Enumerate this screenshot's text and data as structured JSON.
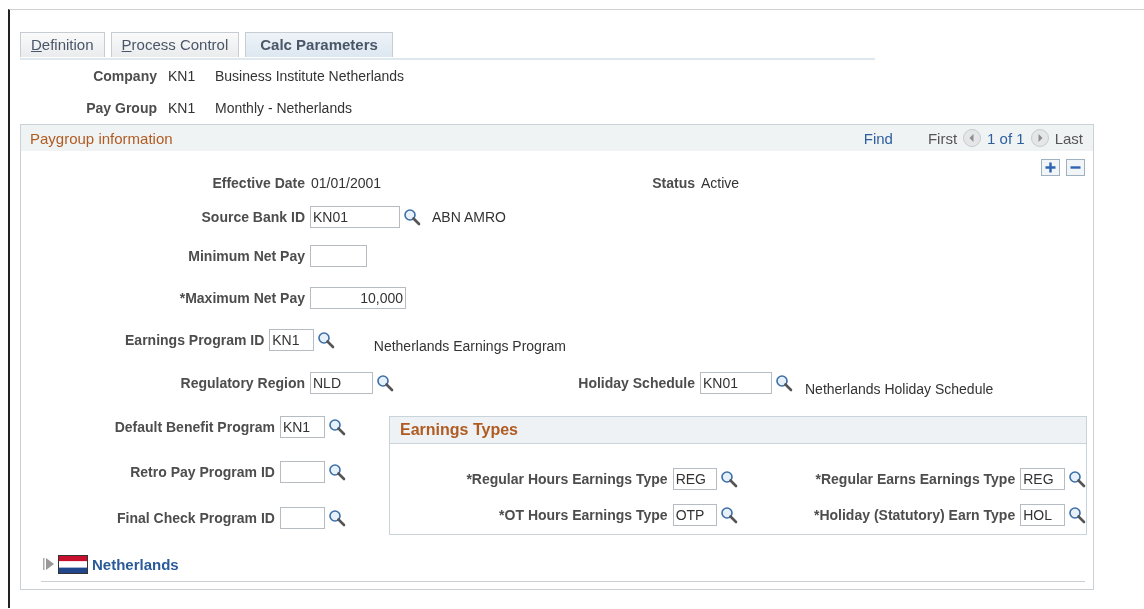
{
  "tabs": [
    {
      "label": "Definition",
      "selected": false,
      "underline_first": true
    },
    {
      "label": "Process Control",
      "selected": false,
      "underline_first": true
    },
    {
      "label": "Calc Parameters",
      "selected": true,
      "underline_first": false
    }
  ],
  "header": [
    {
      "label": "Company",
      "code": "KN1",
      "description": "Business Institute Netherlands"
    },
    {
      "label": "Pay Group",
      "code": "KN1",
      "description": "Monthly - Netherlands"
    }
  ],
  "panel": {
    "title": "Paygroup information",
    "nav": {
      "find": "Find",
      "first": "First",
      "count": "1 of 1",
      "last": "Last"
    },
    "effective_date": {
      "label": "Effective Date",
      "value": "01/01/2001"
    },
    "status": {
      "label": "Status",
      "value": "Active"
    },
    "rows": [
      {
        "label": "Source Bank ID",
        "value": "KN01",
        "numeric": false,
        "lookup": true,
        "description": "ABN AMRO"
      },
      {
        "label": "Minimum Net Pay",
        "lookup": false
      },
      {
        "label": "*Maximum Net Pay",
        "value": "10,000",
        "numeric": true,
        "lookup": false
      },
      {
        "label": "Earnings Program ID",
        "value": "KN1",
        "numeric": false,
        "lookup": true,
        "description": "Netherlands Earnings Program"
      },
      {
        "label": "Regulatory Region",
        "value": "NLD",
        "numeric": false,
        "lookup": true,
        "right": {
          "label": "Holiday Schedule",
          "value": "KN01",
          "lookup": true,
          "description": "Netherlands Holiday Schedule"
        }
      }
    ],
    "lower_rows": [
      {
        "label": "Default Benefit Program",
        "value": "KN1",
        "lookup": true
      },
      {
        "label": "Retro Pay Program ID",
        "lookup": true
      },
      {
        "label": "Final Check Program ID",
        "lookup": true
      }
    ],
    "earnings_types": {
      "title": "Earnings Types",
      "rows": [
        [
          {
            "label": "*Regular Hours Earnings Type",
            "value": "REG"
          },
          {
            "label": "*Regular Earns Earnings Type",
            "value": "REG"
          }
        ],
        [
          {
            "label": "*OT Hours Earnings Type",
            "value": "OTP"
          },
          {
            "label": "*Holiday (Statutory) Earn Type",
            "value": "HOL"
          }
        ]
      ]
    },
    "country": {
      "label": "Netherlands",
      "expanded": false
    }
  }
}
